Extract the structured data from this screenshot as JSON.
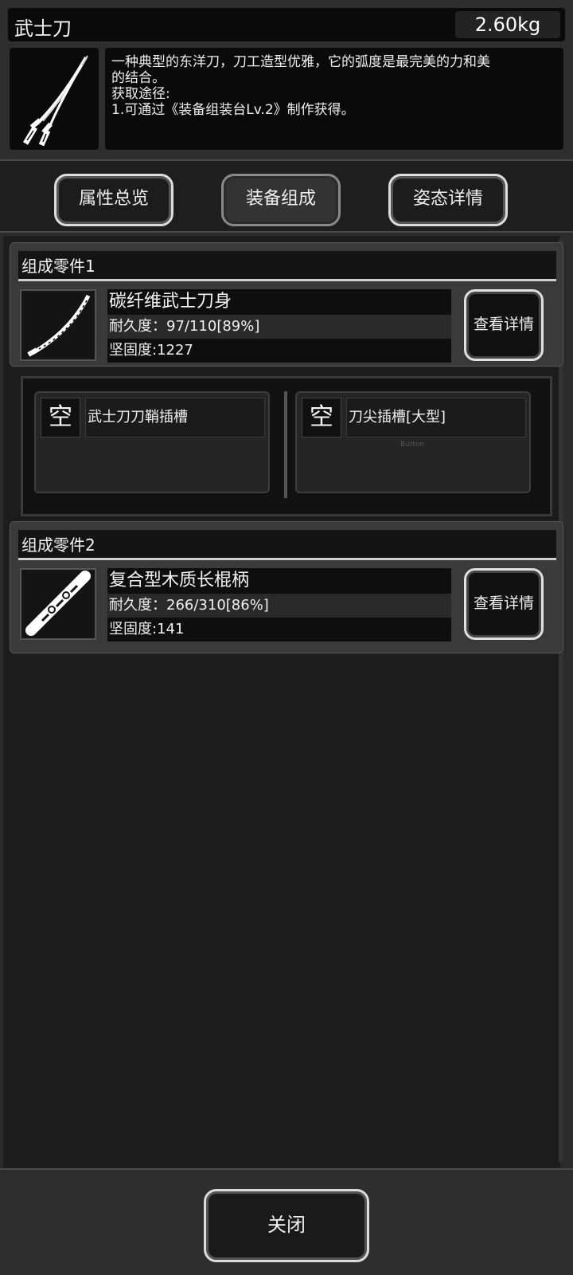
{
  "item": {
    "name": "武士刀",
    "weight": "2.60kg",
    "description_lines": [
      "一种典型的东洋刀，刀工造型优雅，它的弧度是最完美的力和美",
      "的结合。",
      "获取途径:",
      "1.可通过《装备组装台Lv.2》制作获得。"
    ],
    "icon": "katana-icon"
  },
  "tabs": [
    {
      "label": "属性总览"
    },
    {
      "label": "装备组成"
    },
    {
      "label": "姿态详情"
    }
  ],
  "parts": [
    {
      "header": "组成零件1",
      "name": "碳纤维武士刀身",
      "durability": "耐久度：97/110[89%]",
      "hardness": "坚固度:1227",
      "detail_label": "查看详情",
      "icon": "blade-icon"
    },
    {
      "header": "组成零件2",
      "name": "复合型木质长棍柄",
      "durability": "耐久度：266/310[86%]",
      "hardness": "坚固度:141",
      "detail_label": "查看详情",
      "icon": "handle-icon"
    }
  ],
  "slots": [
    {
      "state": "空",
      "label": "武士刀刀鞘插槽"
    },
    {
      "state": "空",
      "label": "刀尖插槽[大型]",
      "sub": "Button"
    }
  ],
  "footer": {
    "close_label": "关闭"
  }
}
